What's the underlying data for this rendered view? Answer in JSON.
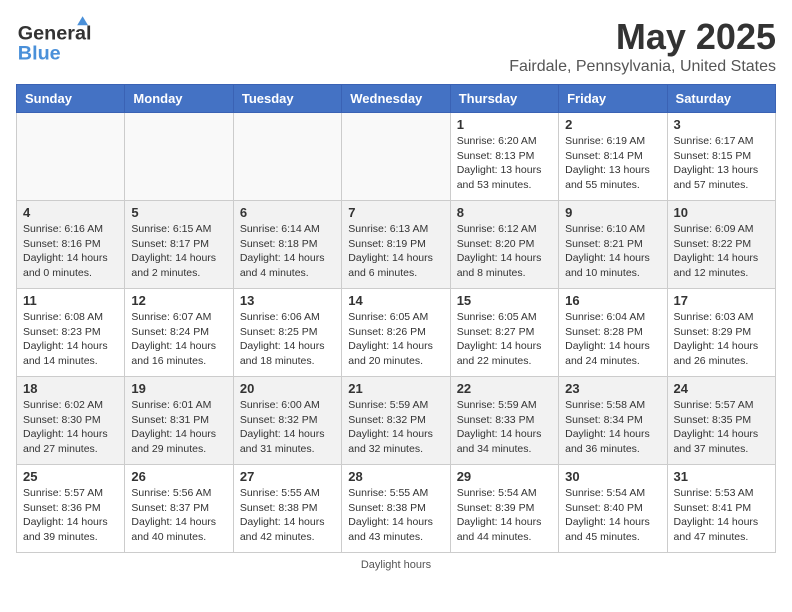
{
  "header": {
    "logo_general": "General",
    "logo_blue": "Blue",
    "title": "May 2025",
    "subtitle": "Fairdale, Pennsylvania, United States"
  },
  "weekdays": [
    "Sunday",
    "Monday",
    "Tuesday",
    "Wednesday",
    "Thursday",
    "Friday",
    "Saturday"
  ],
  "weeks": [
    [
      {
        "day": "",
        "info": ""
      },
      {
        "day": "",
        "info": ""
      },
      {
        "day": "",
        "info": ""
      },
      {
        "day": "",
        "info": ""
      },
      {
        "day": "1",
        "info": "Sunrise: 6:20 AM\nSunset: 8:13 PM\nDaylight: 13 hours\nand 53 minutes."
      },
      {
        "day": "2",
        "info": "Sunrise: 6:19 AM\nSunset: 8:14 PM\nDaylight: 13 hours\nand 55 minutes."
      },
      {
        "day": "3",
        "info": "Sunrise: 6:17 AM\nSunset: 8:15 PM\nDaylight: 13 hours\nand 57 minutes."
      }
    ],
    [
      {
        "day": "4",
        "info": "Sunrise: 6:16 AM\nSunset: 8:16 PM\nDaylight: 14 hours\nand 0 minutes."
      },
      {
        "day": "5",
        "info": "Sunrise: 6:15 AM\nSunset: 8:17 PM\nDaylight: 14 hours\nand 2 minutes."
      },
      {
        "day": "6",
        "info": "Sunrise: 6:14 AM\nSunset: 8:18 PM\nDaylight: 14 hours\nand 4 minutes."
      },
      {
        "day": "7",
        "info": "Sunrise: 6:13 AM\nSunset: 8:19 PM\nDaylight: 14 hours\nand 6 minutes."
      },
      {
        "day": "8",
        "info": "Sunrise: 6:12 AM\nSunset: 8:20 PM\nDaylight: 14 hours\nand 8 minutes."
      },
      {
        "day": "9",
        "info": "Sunrise: 6:10 AM\nSunset: 8:21 PM\nDaylight: 14 hours\nand 10 minutes."
      },
      {
        "day": "10",
        "info": "Sunrise: 6:09 AM\nSunset: 8:22 PM\nDaylight: 14 hours\nand 12 minutes."
      }
    ],
    [
      {
        "day": "11",
        "info": "Sunrise: 6:08 AM\nSunset: 8:23 PM\nDaylight: 14 hours\nand 14 minutes."
      },
      {
        "day": "12",
        "info": "Sunrise: 6:07 AM\nSunset: 8:24 PM\nDaylight: 14 hours\nand 16 minutes."
      },
      {
        "day": "13",
        "info": "Sunrise: 6:06 AM\nSunset: 8:25 PM\nDaylight: 14 hours\nand 18 minutes."
      },
      {
        "day": "14",
        "info": "Sunrise: 6:05 AM\nSunset: 8:26 PM\nDaylight: 14 hours\nand 20 minutes."
      },
      {
        "day": "15",
        "info": "Sunrise: 6:05 AM\nSunset: 8:27 PM\nDaylight: 14 hours\nand 22 minutes."
      },
      {
        "day": "16",
        "info": "Sunrise: 6:04 AM\nSunset: 8:28 PM\nDaylight: 14 hours\nand 24 minutes."
      },
      {
        "day": "17",
        "info": "Sunrise: 6:03 AM\nSunset: 8:29 PM\nDaylight: 14 hours\nand 26 minutes."
      }
    ],
    [
      {
        "day": "18",
        "info": "Sunrise: 6:02 AM\nSunset: 8:30 PM\nDaylight: 14 hours\nand 27 minutes."
      },
      {
        "day": "19",
        "info": "Sunrise: 6:01 AM\nSunset: 8:31 PM\nDaylight: 14 hours\nand 29 minutes."
      },
      {
        "day": "20",
        "info": "Sunrise: 6:00 AM\nSunset: 8:32 PM\nDaylight: 14 hours\nand 31 minutes."
      },
      {
        "day": "21",
        "info": "Sunrise: 5:59 AM\nSunset: 8:32 PM\nDaylight: 14 hours\nand 32 minutes."
      },
      {
        "day": "22",
        "info": "Sunrise: 5:59 AM\nSunset: 8:33 PM\nDaylight: 14 hours\nand 34 minutes."
      },
      {
        "day": "23",
        "info": "Sunrise: 5:58 AM\nSunset: 8:34 PM\nDaylight: 14 hours\nand 36 minutes."
      },
      {
        "day": "24",
        "info": "Sunrise: 5:57 AM\nSunset: 8:35 PM\nDaylight: 14 hours\nand 37 minutes."
      }
    ],
    [
      {
        "day": "25",
        "info": "Sunrise: 5:57 AM\nSunset: 8:36 PM\nDaylight: 14 hours\nand 39 minutes."
      },
      {
        "day": "26",
        "info": "Sunrise: 5:56 AM\nSunset: 8:37 PM\nDaylight: 14 hours\nand 40 minutes."
      },
      {
        "day": "27",
        "info": "Sunrise: 5:55 AM\nSunset: 8:38 PM\nDaylight: 14 hours\nand 42 minutes."
      },
      {
        "day": "28",
        "info": "Sunrise: 5:55 AM\nSunset: 8:38 PM\nDaylight: 14 hours\nand 43 minutes."
      },
      {
        "day": "29",
        "info": "Sunrise: 5:54 AM\nSunset: 8:39 PM\nDaylight: 14 hours\nand 44 minutes."
      },
      {
        "day": "30",
        "info": "Sunrise: 5:54 AM\nSunset: 8:40 PM\nDaylight: 14 hours\nand 45 minutes."
      },
      {
        "day": "31",
        "info": "Sunrise: 5:53 AM\nSunset: 8:41 PM\nDaylight: 14 hours\nand 47 minutes."
      }
    ]
  ],
  "footer": {
    "daylight_hours": "Daylight hours"
  }
}
